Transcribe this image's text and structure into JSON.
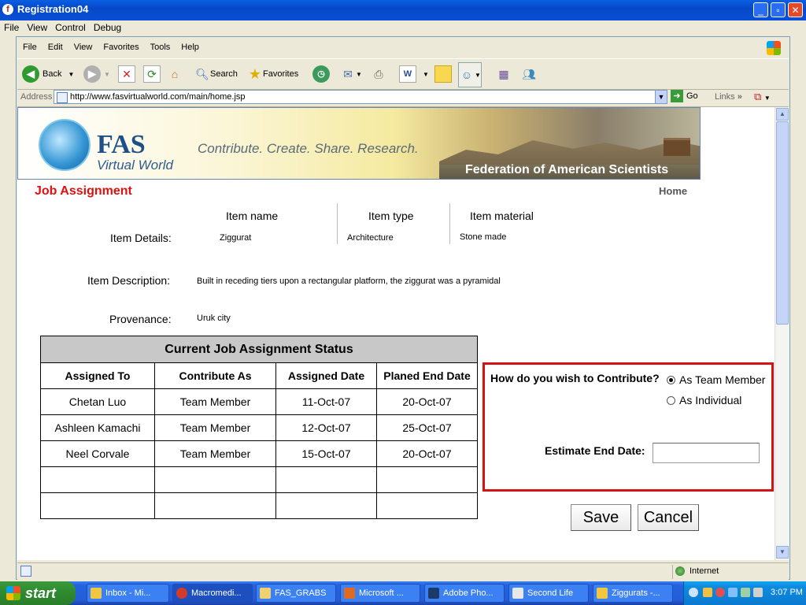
{
  "window": {
    "title": "Registration04",
    "controls": [
      "minimize",
      "maximize",
      "close"
    ]
  },
  "outer_menu": [
    "File",
    "View",
    "Control",
    "Debug"
  ],
  "ie_menu": [
    "File",
    "Edit",
    "View",
    "Favorites",
    "Tools",
    "Help"
  ],
  "toolbar": {
    "back": "Back",
    "search": "Search",
    "favorites": "Favorites"
  },
  "address": {
    "label": "Address",
    "url": "http://www.fasvirtualworld.com/main/home.jsp",
    "go": "Go",
    "links": "Links"
  },
  "banner": {
    "logo_main": "FAS",
    "logo_sub": "Virtual World",
    "tagline": "Contribute. Create. Share. Research.",
    "org": "Federation of American Scientists"
  },
  "page": {
    "title": "Job Assignment",
    "home_link": "Home",
    "item_headers": [
      "Item name",
      "Item type",
      "Item material"
    ],
    "item_details_label": "Item Details:",
    "item_details": [
      "Ziggurat",
      "Architecture",
      "Stone made"
    ],
    "description_label": "Item Description:",
    "description": "Built in receding tiers upon a rectangular platform, the ziggurat was a pyramidal",
    "provenance_label": "Provenance:",
    "provenance": "Uruk city"
  },
  "status_table": {
    "caption": "Current Job Assignment Status",
    "columns": [
      "Assigned To",
      "Contribute As",
      "Assigned Date",
      "Planed End Date"
    ],
    "rows": [
      [
        "Chetan Luo",
        "Team Member",
        "11-Oct-07",
        "20-Oct-07"
      ],
      [
        "Ashleen Kamachi",
        "Team Member",
        "12-Oct-07",
        "25-Oct-07"
      ],
      [
        "Neel Corvale",
        "Team Member",
        "15-Oct-07",
        "20-Oct-07"
      ],
      [
        "",
        "",
        "",
        ""
      ],
      [
        "",
        "",
        "",
        ""
      ]
    ]
  },
  "contribute": {
    "question": "How do you wish to Contribute?",
    "options": [
      "As Team Member",
      "As Individual"
    ],
    "selected": "As Team Member",
    "end_date_label": "Estimate End Date:",
    "end_date_value": ""
  },
  "buttons": {
    "save": "Save",
    "cancel": "Cancel"
  },
  "statusbar": {
    "zone": "Internet"
  },
  "taskbar": {
    "start": "start",
    "tasks": [
      "Inbox - Mi...",
      "Macromedi...",
      "FAS_GRABS",
      "Microsoft ...",
      "Adobe Pho...",
      "Second Life",
      "Ziggurats -..."
    ],
    "clock": "3:07 PM"
  }
}
